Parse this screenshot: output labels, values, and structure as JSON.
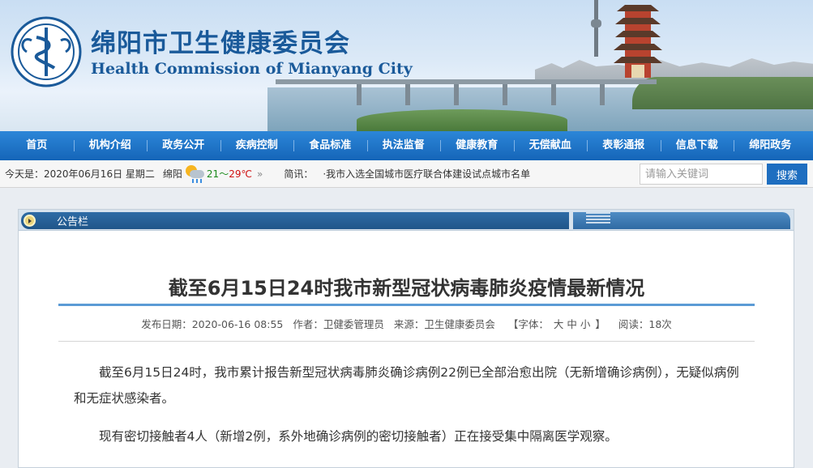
{
  "site": {
    "title_cn": "绵阳市卫生健康委员会",
    "title_en": "Health Commission of Mianyang City"
  },
  "nav": {
    "items": [
      "首页",
      "机构介绍",
      "政务公开",
      "疾病控制",
      "食品标准",
      "执法监督",
      "健康教育",
      "无偿献血",
      "表彰通报",
      "信息下载",
      "绵阳政务"
    ]
  },
  "infobar": {
    "today": "今天是：2020年06月16日 星期二",
    "city": "绵阳",
    "weather_icon": "partly-cloudy-rain-icon",
    "temp_low": "21",
    "temp_sep": "～",
    "temp_high": "29℃",
    "arrow": "»",
    "news_label": "简讯：",
    "news_text": "·我市入选全国城市医疗联合体建设试点城市名单"
  },
  "search": {
    "placeholder": "请输入关键词",
    "button": "搜索"
  },
  "panel": {
    "label": "公告栏"
  },
  "article": {
    "title": "截至6月15日24时我市新型冠状病毒肺炎疫情最新情况",
    "meta": {
      "date": "发布日期：2020-06-16 08:55",
      "author": "作者：卫健委管理员",
      "source": "来源：卫生健康委员会",
      "font_label": "【字体：",
      "font_large": "大",
      "font_medium": "中",
      "font_small": "小",
      "font_close": "】",
      "views": "阅读：18次"
    },
    "paragraphs": [
      "截至6月15日24时，我市累计报告新型冠状病毒肺炎确诊病例22例已全部治愈出院（无新增确诊病例），无疑似病例和无症状感染者。",
      "现有密切接触者4人（新增2例，系外地确诊病例的密切接触者）正在接受集中隔离医学观察。"
    ]
  },
  "colors": {
    "nav_bg": "#1565b8",
    "title_blue": "#1a5a9a",
    "rule_blue": "#5b9bd5",
    "temp_high": "#d01010",
    "temp_low": "#1a8a1a"
  }
}
